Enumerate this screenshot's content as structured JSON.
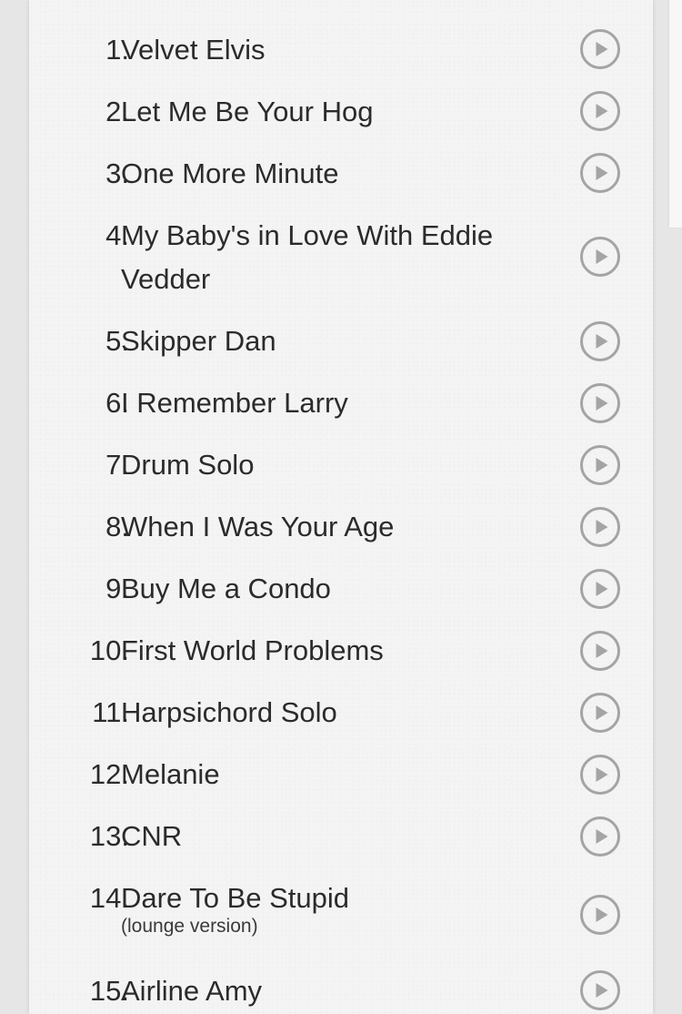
{
  "tracklist": {
    "tracks": [
      {
        "number": "1.",
        "title": "Velvet Elvis",
        "subtitle": "",
        "icon": "play-circle-icon"
      },
      {
        "number": "2.",
        "title": "Let Me Be Your Hog",
        "subtitle": "",
        "icon": "play-circle-icon"
      },
      {
        "number": "3.",
        "title": "One More Minute",
        "subtitle": "",
        "icon": "play-circle-icon"
      },
      {
        "number": "4.",
        "title": "My Baby's in Love With Eddie Vedder",
        "subtitle": "",
        "icon": "play-circle-icon"
      },
      {
        "number": "5.",
        "title": "Skipper Dan",
        "subtitle": "",
        "icon": "play-circle-icon"
      },
      {
        "number": "6.",
        "title": "I Remember Larry",
        "subtitle": "",
        "icon": "play-circle-icon"
      },
      {
        "number": "7.",
        "title": "Drum Solo",
        "subtitle": "",
        "icon": "play-circle-icon"
      },
      {
        "number": "8.",
        "title": "When I Was Your Age",
        "subtitle": "",
        "icon": "play-circle-icon"
      },
      {
        "number": "9.",
        "title": "Buy Me a Condo",
        "subtitle": "",
        "icon": "play-circle-icon"
      },
      {
        "number": "10.",
        "title": "First World Problems",
        "subtitle": "",
        "icon": "play-circle-icon"
      },
      {
        "number": "11.",
        "title": "Harpsichord Solo",
        "subtitle": "",
        "icon": "play-circle-icon"
      },
      {
        "number": "12.",
        "title": "Melanie",
        "subtitle": "",
        "icon": "play-circle-icon"
      },
      {
        "number": "13.",
        "title": "CNR",
        "subtitle": "",
        "icon": "play-circle-icon"
      },
      {
        "number": "14.",
        "title": "Dare To Be Stupid",
        "subtitle": "(lounge version)",
        "icon": "play-circle-icon"
      },
      {
        "number": "15.",
        "title": "Airline Amy",
        "subtitle": "",
        "icon": "play-circle-icon"
      }
    ]
  },
  "colors": {
    "text": "#2b2b2b",
    "play_icon": "#a4a4a4",
    "card_background": "#f4f4f4"
  }
}
